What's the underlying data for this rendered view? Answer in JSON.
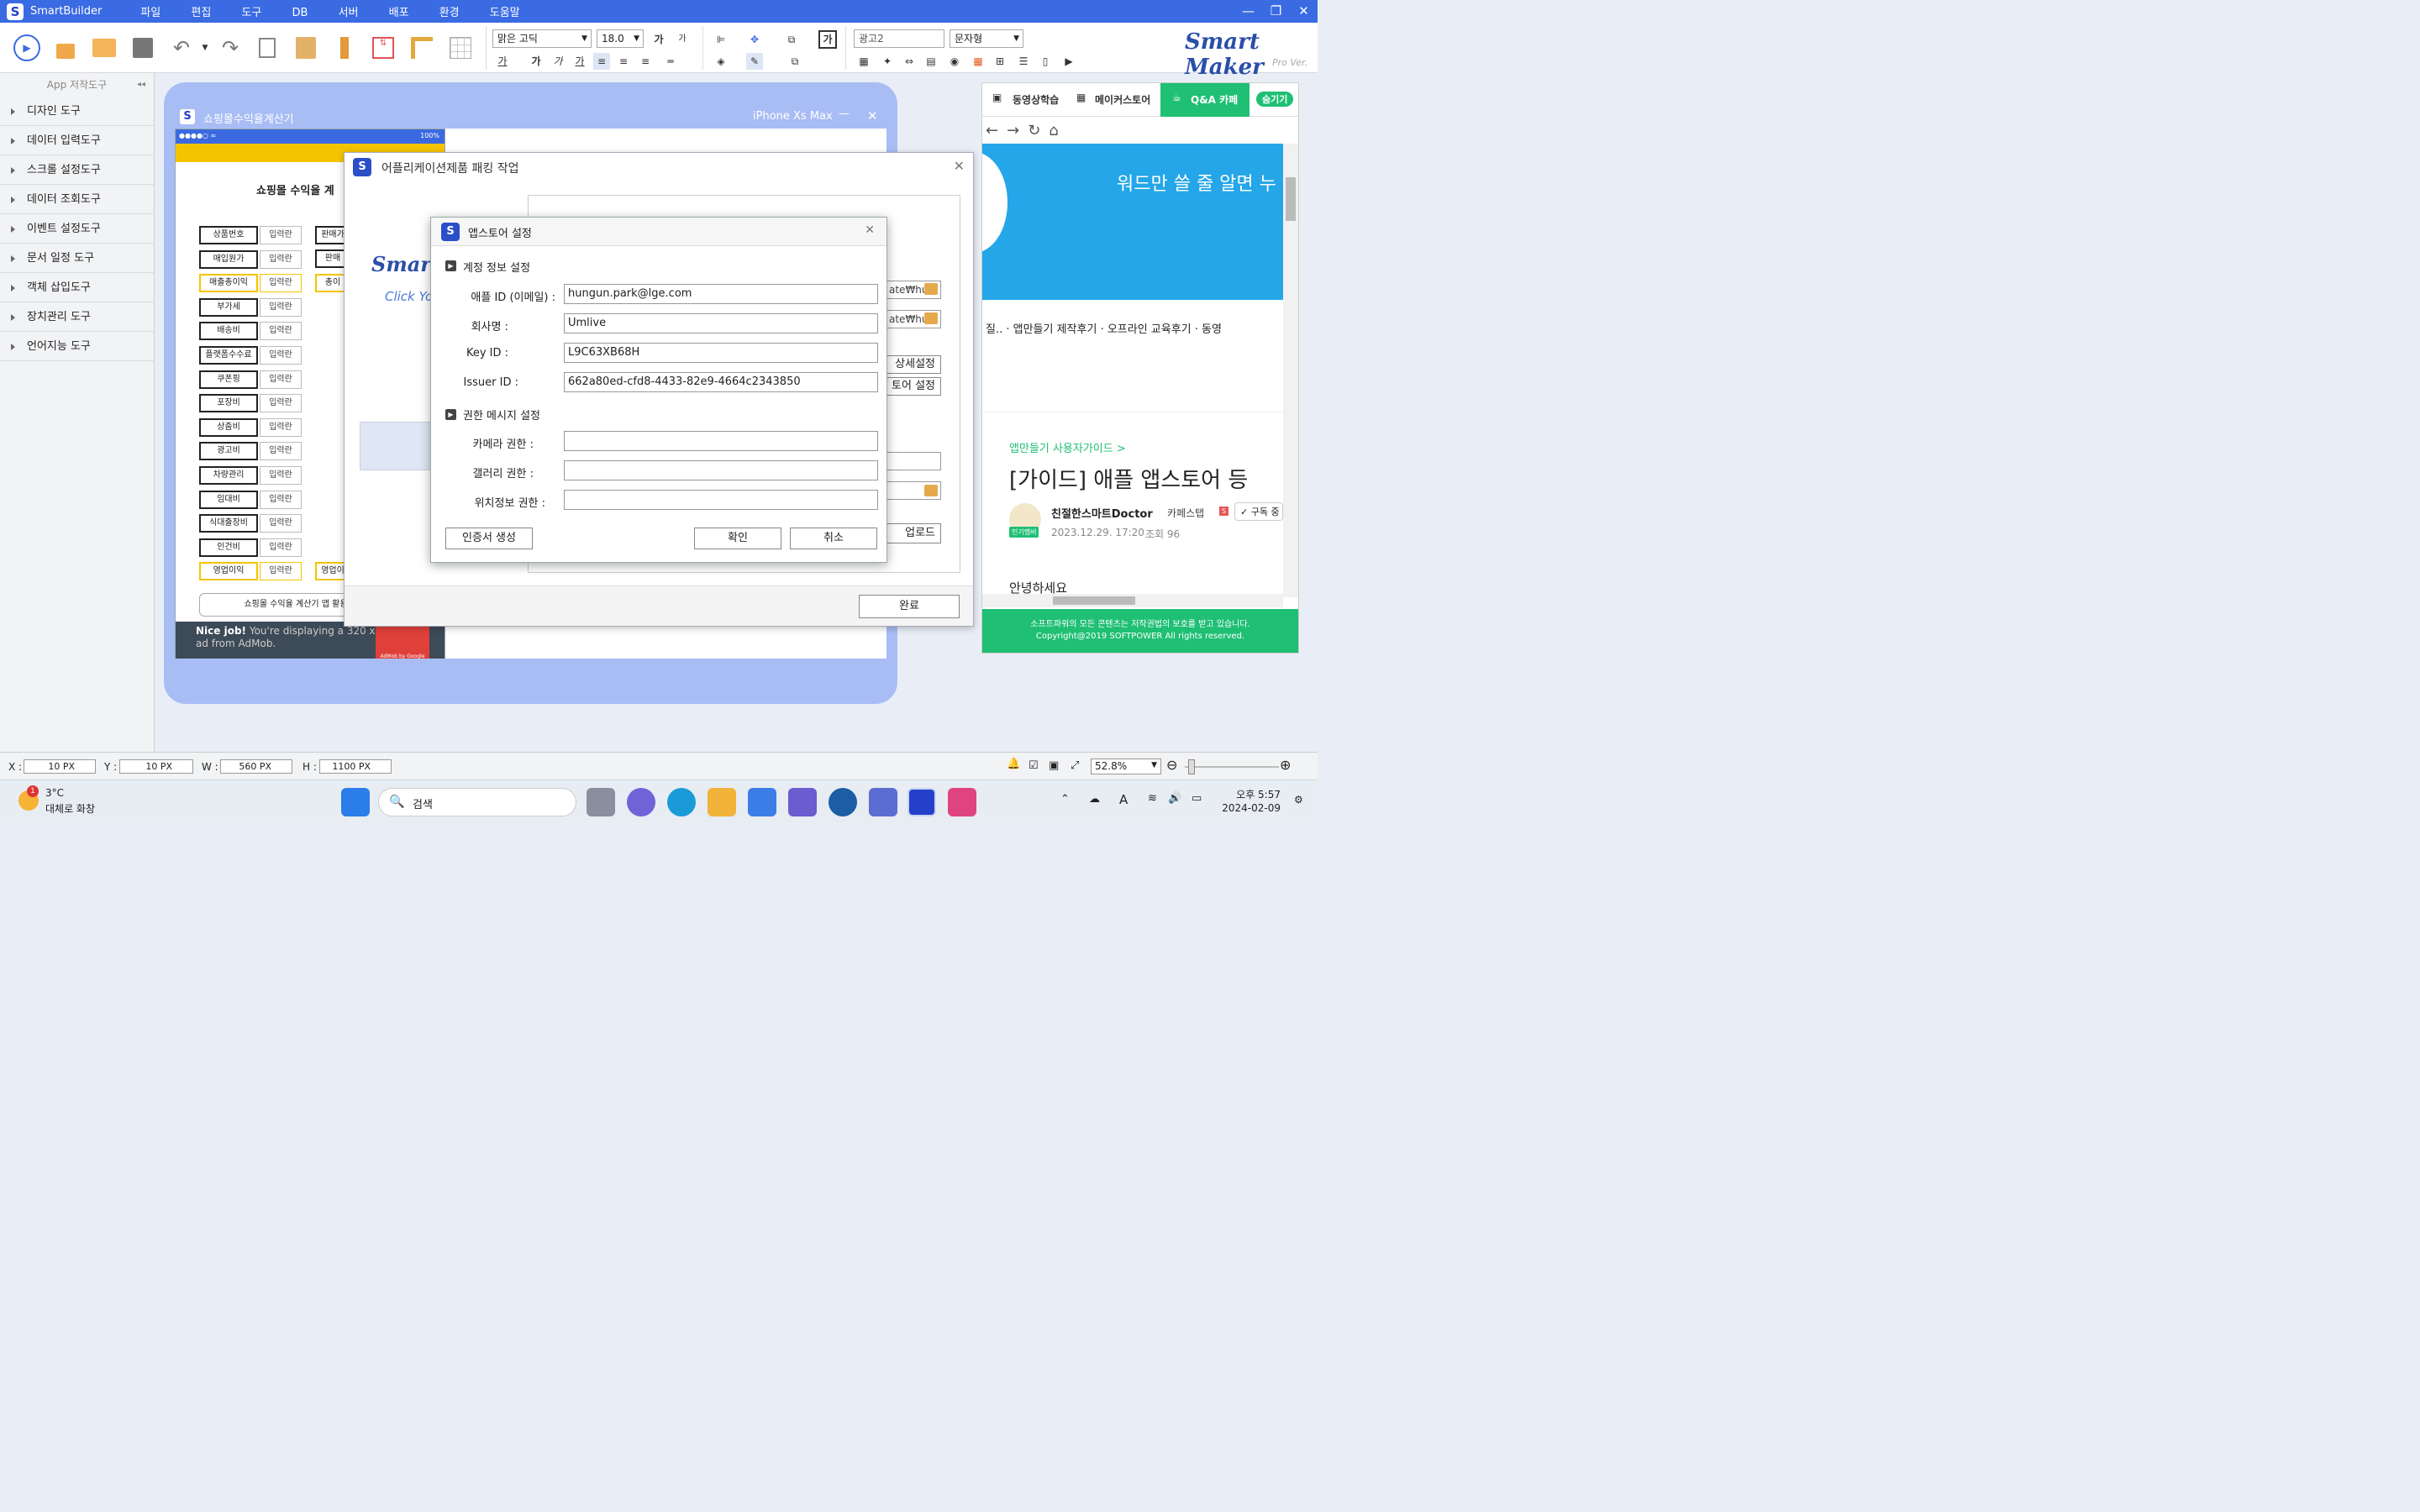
{
  "titlebar": {
    "app": "SmartBuilder",
    "menus": [
      "파일",
      "편집",
      "도구",
      "DB",
      "서버",
      "배포",
      "환경",
      "도움말"
    ]
  },
  "toolbar": {
    "font": "맑은 고딕",
    "size": "18.0",
    "object_name": "광고2",
    "object_type": "문자형",
    "brand": "Smart Maker",
    "brand_sub": "Pro Ver."
  },
  "sidebar": {
    "title": "App 저작도구",
    "items": [
      "디자인 도구",
      "데이터 입력도구",
      "스크롤 설정도구",
      "데이터 조회도구",
      "이벤트 설정도구",
      "문서 일정 도구",
      "객체 삽입도구",
      "장치관리 도구",
      "언어지능 도구"
    ]
  },
  "phone": {
    "title": "쇼핑몰수익율계산기",
    "device": "iPhone Xs Max",
    "battery": "100%",
    "heading": "쇼핑몰 수익율 계",
    "placeholder": "입력란",
    "rows": [
      "상품번호",
      "매입원가",
      "매출총이익",
      "부가세",
      "배송비",
      "플랫폼수수료",
      "쿠폰핑",
      "포장비",
      "상줌비",
      "광고비",
      "차량관리",
      "임대비",
      "식대출장비",
      "인건비",
      "영업이익"
    ],
    "right_rows": [
      "판매가",
      "판매",
      "총이",
      "영업이"
    ],
    "footer_btn": "쇼핑몰 수익율 계산기 앱 활용",
    "ad_title": "Nice job!",
    "ad_text": "You're displaying a 320 x 50 test ad from AdMob.",
    "ad_brand": "AdMob by Google"
  },
  "pack": {
    "title": "어플리케이션제품 패킹 작업",
    "logo": "Smart",
    "logo2": "Click Yo",
    "path1": "ate₩hu",
    "path2": "ate₩hu",
    "btn_detail": "상세설정",
    "btn_store": "토어 설정",
    "btn_upload": "업로드",
    "btn_done": "완료"
  },
  "appstore": {
    "title": "앱스토어 설정",
    "sec1": "계정 정보 설정",
    "sec2": "권한 메시지 설정",
    "fields": [
      {
        "label": "애플 ID (이메일) :",
        "value": "hungun.park@lge.com"
      },
      {
        "label": "회사명 :",
        "value": "Umlive"
      },
      {
        "label": "Key ID :",
        "value": "L9C63XB68H"
      },
      {
        "label": "Issuer ID :",
        "value": "662a80ed-cfd8-4433-82e9-4664c2343850"
      }
    ],
    "perms": [
      {
        "label": "카메라 권한 :",
        "value": ""
      },
      {
        "label": "갤러리 권한 :",
        "value": ""
      },
      {
        "label": "위치정보 권한 :",
        "value": ""
      }
    ],
    "btn_cert": "인증서 생성",
    "btn_ok": "확인",
    "btn_cancel": "취소"
  },
  "right": {
    "tabs": [
      "동영상학습",
      "메이커스토어",
      "Q&A 카페",
      "숨기기"
    ],
    "banner": "워드만 쓸 줄 알면 누",
    "links": "질..  ·  앱만들기 제작후기  ·  오프라인 교육후기  ·  동영",
    "category": "앱만들기 사용자가이드 >",
    "post_title": "[가이드] 애플 앱스토어 등",
    "author": "친절한스마트Doctor",
    "cafe": "카페스탭",
    "subscribe": "구독 중",
    "badge": "인기멤버",
    "date": "2023.12.29. 17:20",
    "views": "조회 96",
    "greeting": "안녕하세요",
    "footer1": "소프트파워의 모든 콘텐츠는 저작권법의 보호를 받고 있습니다.",
    "footer2": "Copyright@2019 SOFTPOWER All rights reserved."
  },
  "status": {
    "x": "10",
    "y": "10",
    "w": "560",
    "h": "1100",
    "unit": "PX",
    "zoom": "52.8%"
  },
  "taskbar": {
    "temp": "3°C",
    "weather": "대체로 화창",
    "search": "검색",
    "time": "오후 5:57",
    "date": "2024-02-09"
  }
}
